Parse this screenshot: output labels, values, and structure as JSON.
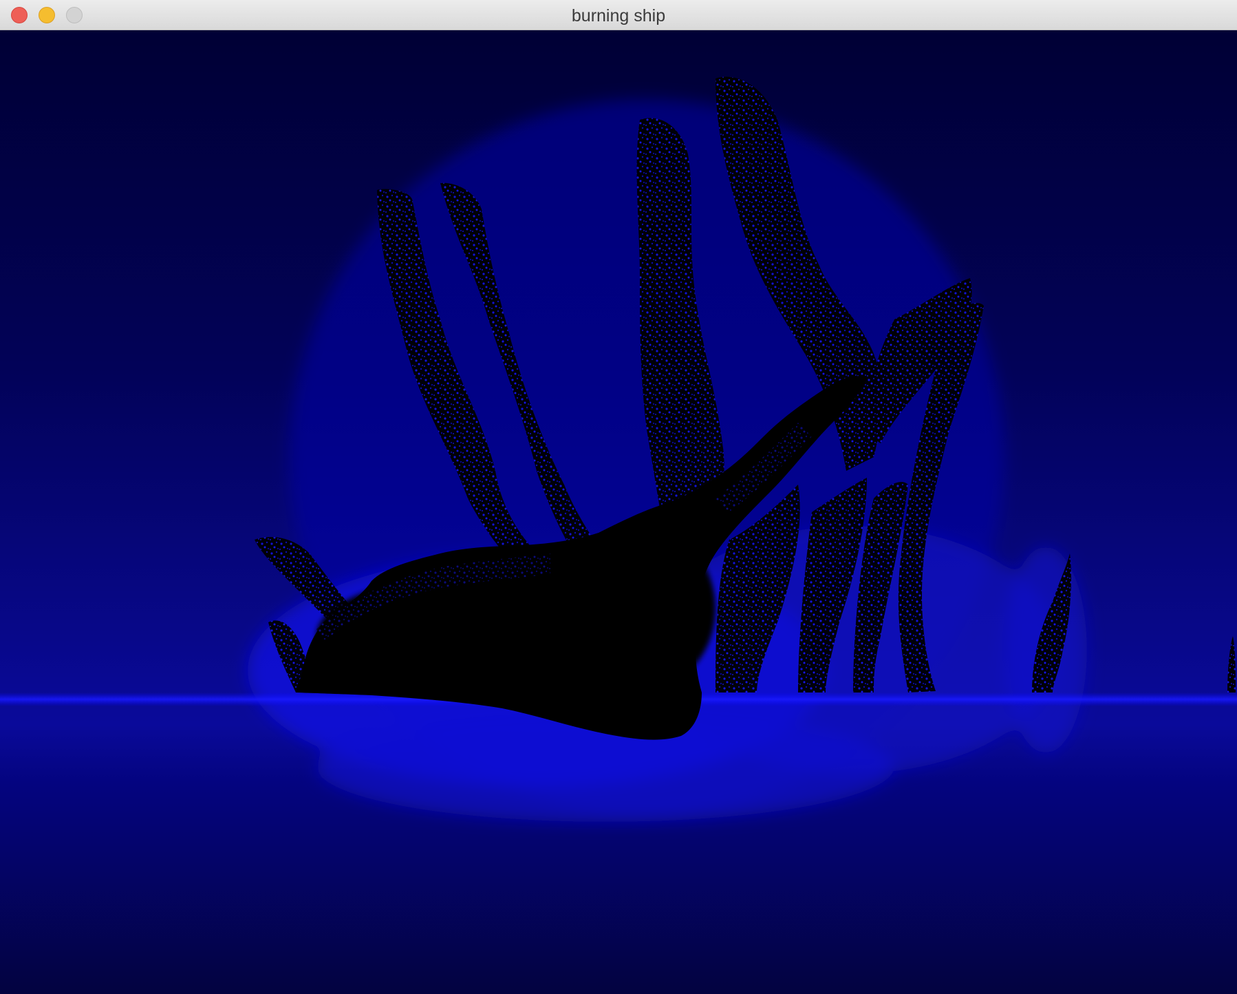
{
  "window": {
    "title": "burning ship"
  },
  "colors": {
    "set": "#000000",
    "glow": "#0000ff",
    "deep": "#020240",
    "top": "#000030"
  },
  "icons": {
    "close": "close-icon",
    "minimize": "minimize-icon",
    "zoom": "zoom-icon"
  }
}
